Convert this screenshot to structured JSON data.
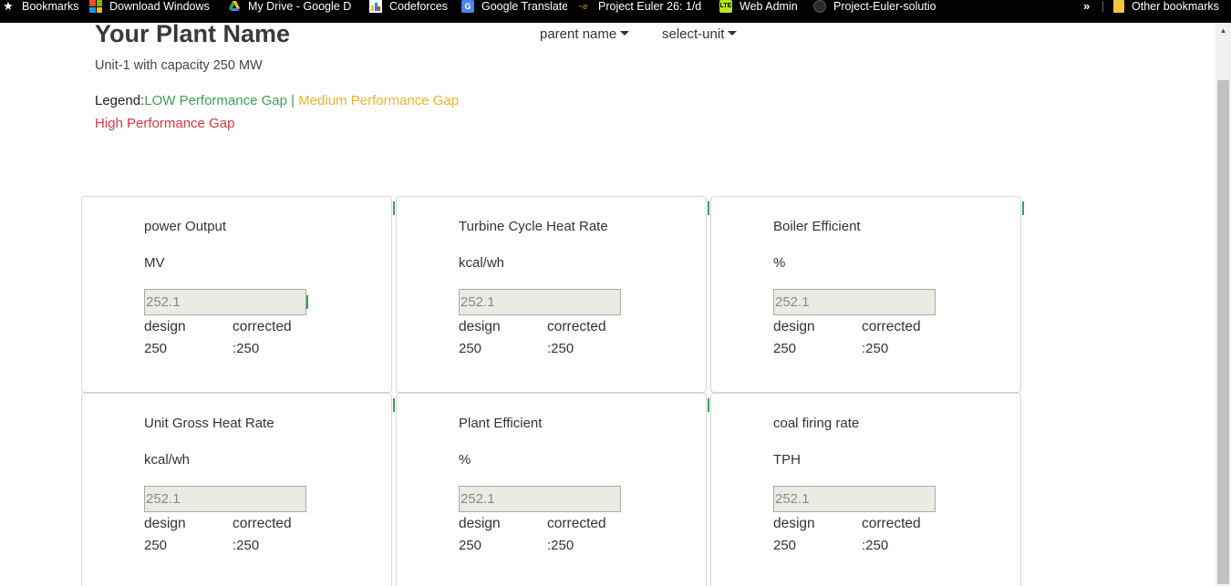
{
  "bookmarks_bar": {
    "items": [
      {
        "label": "Bookmarks",
        "icon": "star-icon"
      },
      {
        "label": "Download Windows",
        "icon": "windows-icon"
      },
      {
        "label": "My Drive - Google D",
        "icon": "google-drive-icon"
      },
      {
        "label": "Codeforces",
        "icon": "codeforces-icon"
      },
      {
        "label": "Google Translate",
        "icon": "google-translate-icon"
      },
      {
        "label": "Project Euler 26: 1/d",
        "icon": "project-euler-icon"
      },
      {
        "label": "Web Admin",
        "icon": "lte-icon"
      },
      {
        "label": "Project-Euler-solutio",
        "icon": "github-icon"
      }
    ],
    "overflow": "»",
    "other": {
      "label": "Other bookmarks",
      "icon": "folder-icon"
    }
  },
  "header": {
    "title": "Your Plant Name",
    "parent_dropdown": "parent name",
    "unit_dropdown": "select-unit",
    "unit_capacity": "Unit-1 with capacity 250 MW"
  },
  "legend": {
    "prefix": "Legend:",
    "low": "LOW Performance Gap",
    "separator": "|",
    "medium": "Medium Performance Gap",
    "high": "High Performance Gap",
    "colors": {
      "low": "#3aa055",
      "medium": "#f0b429",
      "high": "#dc3545"
    }
  },
  "cards": [
    {
      "title": "power Output",
      "unit": "MV",
      "value": "252.1",
      "design_label": "design",
      "corrected_label": "corrected",
      "design_value": "250",
      "corrected_value": ":250"
    },
    {
      "title": "Turbine Cycle Heat Rate",
      "unit": "kcal/wh",
      "value": "252.1",
      "design_label": "design",
      "corrected_label": "corrected",
      "design_value": "250",
      "corrected_value": ":250"
    },
    {
      "title": "Boiler Efficient",
      "unit": "%",
      "value": "252.1",
      "design_label": "design",
      "corrected_label": "corrected",
      "design_value": "250",
      "corrected_value": ":250"
    },
    {
      "title": "Unit Gross Heat Rate",
      "unit": "kcal/wh",
      "value": "252.1",
      "design_label": "design",
      "corrected_label": "corrected",
      "design_value": "250",
      "corrected_value": ":250"
    },
    {
      "title": "Plant Efficient",
      "unit": "%",
      "value": "252.1",
      "design_label": "design",
      "corrected_label": "corrected",
      "design_value": "250",
      "corrected_value": ":250"
    },
    {
      "title": "coal firing rate",
      "unit": "TPH",
      "value": "252.1",
      "design_label": "design",
      "corrected_label": "corrected",
      "design_value": "250",
      "corrected_value": ":250"
    }
  ]
}
